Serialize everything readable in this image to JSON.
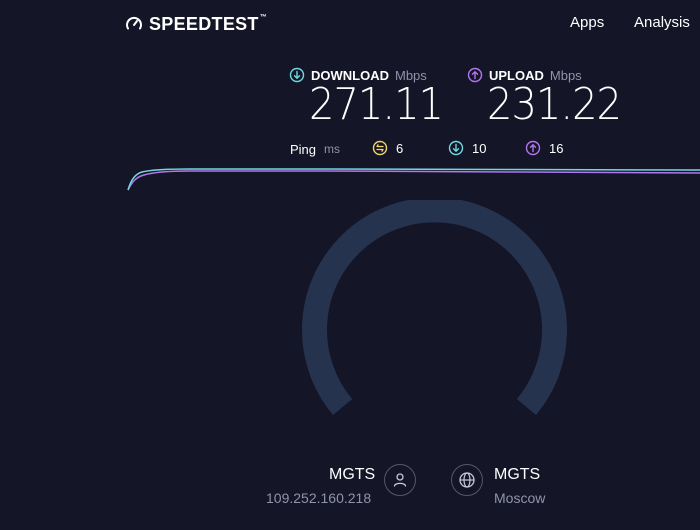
{
  "header": {
    "logo_text": "SPEEDTEST",
    "logo_tm": "™",
    "nav": [
      {
        "label": "Apps"
      },
      {
        "label": "Analysis"
      }
    ]
  },
  "download": {
    "label": "DOWNLOAD",
    "unit": "Mbps",
    "value": "271.11",
    "color": "#6fd9e0"
  },
  "upload": {
    "label": "UPLOAD",
    "unit": "Mbps",
    "value": "231.22",
    "color": "#b177ef"
  },
  "ping": {
    "label": "Ping",
    "unit": "ms",
    "idle": {
      "value": "6",
      "color": "#f3d56b"
    },
    "download": {
      "value": "10",
      "color": "#6fd9e0"
    },
    "upload": {
      "value": "16",
      "color": "#b177ef"
    }
  },
  "provider": {
    "name": "MGTS",
    "ip": "109.252.160.218"
  },
  "server": {
    "name": "MGTS",
    "location": "Moscow"
  },
  "colors": {
    "background": "#141526",
    "gauge_track": "#26334f",
    "muted_text": "#9193a8"
  }
}
